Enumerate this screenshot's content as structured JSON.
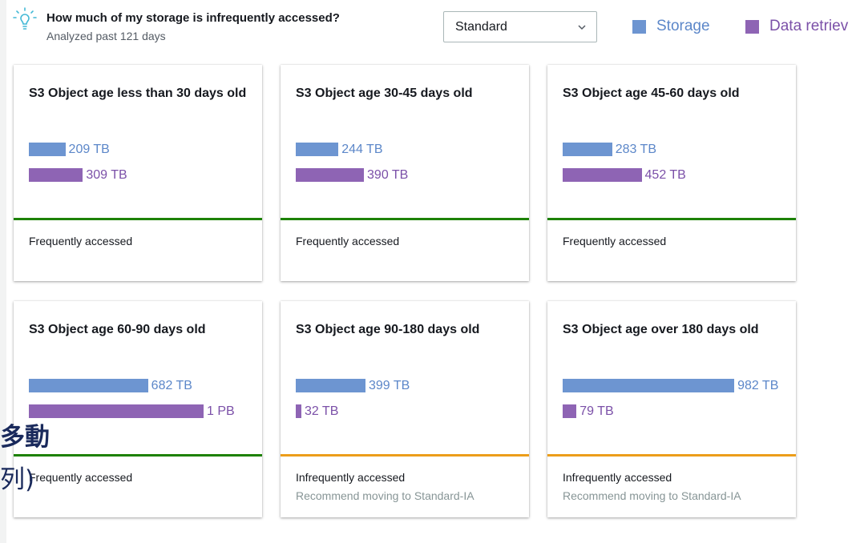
{
  "header": {
    "title": "How much of my storage is infrequently accessed?",
    "subtitle": "Analyzed past 121 days",
    "icon": "lightbulb-icon"
  },
  "storage_class_select": {
    "value": "Standard",
    "icon": "chevron-down-icon"
  },
  "legend": [
    {
      "label": "Storage",
      "color": "#6d95d1"
    },
    {
      "label": "Data retriev",
      "color": "#8e64b4"
    }
  ],
  "colors": {
    "storage": "#6d95d1",
    "retrieval": "#8e64b4",
    "frequent": "#1d8102",
    "infrequent": "#ec9d1a"
  },
  "cards": [
    {
      "title": "S3 Object age less than 30 days old",
      "storage_tb": 209,
      "storage_label": "209 TB",
      "retrieval_tb": 309,
      "retrieval_label": "309 TB",
      "status": "Frequently accessed",
      "recommendation": ""
    },
    {
      "title": "S3 Object age 30-45 days old",
      "storage_tb": 244,
      "storage_label": "244 TB",
      "retrieval_tb": 390,
      "retrieval_label": "390 TB",
      "status": "Frequently accessed",
      "recommendation": ""
    },
    {
      "title": "S3 Object age 45-60 days old",
      "storage_tb": 283,
      "storage_label": "283 TB",
      "retrieval_tb": 452,
      "retrieval_label": "452 TB",
      "status": "Frequently accessed",
      "recommendation": ""
    },
    {
      "title": "S3 Object age 60-90 days old",
      "storage_tb": 682,
      "storage_label": "682 TB",
      "retrieval_tb": 1000,
      "retrieval_label": "1 PB",
      "status": "Frequently accessed",
      "recommendation": ""
    },
    {
      "title": "S3 Object age 90-180 days old",
      "storage_tb": 399,
      "storage_label": "399 TB",
      "retrieval_tb": 32,
      "retrieval_label": "32 TB",
      "status": "Infrequently accessed",
      "recommendation": "Recommend moving to Standard-IA"
    },
    {
      "title": "S3 Object age over 180 days old",
      "storage_tb": 982,
      "storage_label": "982 TB",
      "retrieval_tb": 79,
      "retrieval_label": "79 TB",
      "status": "Infrequently accessed",
      "recommendation": "Recommend moving to Standard-IA"
    }
  ],
  "overlay_text": {
    "line1": "多動",
    "line2": "列)"
  }
}
